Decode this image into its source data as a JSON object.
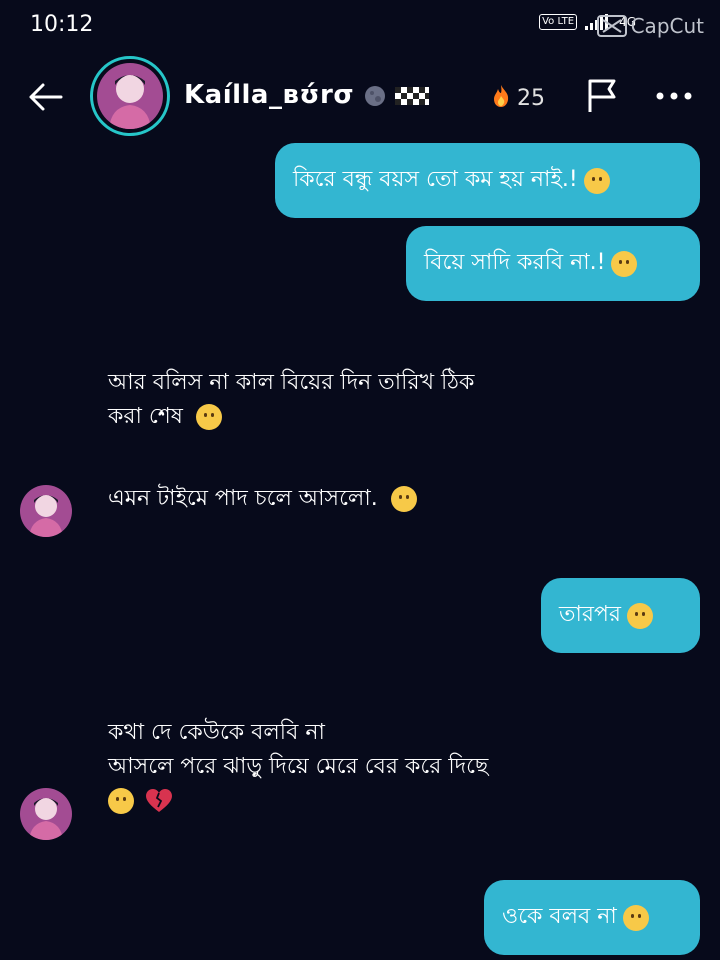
{
  "status_bar": {
    "time": "10:12",
    "volte": "Vo LTE",
    "network": "4G",
    "watermark": "CapCut"
  },
  "header": {
    "username": "Kaílla_вʊ́rσ",
    "streak_count": "25"
  },
  "messages": [
    {
      "dir": "out",
      "text": "কিরে বন্ধু বয়স তো কম হয় নাই.!",
      "emoji": "slightly-smiling-emoji"
    },
    {
      "dir": "out",
      "text": "বিয়ে সাদি করবি না.!",
      "emoji": "unamused-emoji"
    },
    {
      "dir": "in",
      "line1": "আর বলিস না কাল বিয়ের দিন তারিখ ঠিক",
      "line2": "করা শেষ",
      "emoji": "hugging-emoji"
    },
    {
      "dir": "in",
      "text": "এমন টাইমে পাদ চলে আসলো.",
      "emoji": "disappointed-emoji"
    },
    {
      "dir": "out",
      "text": "তারপর",
      "emoji": "thinking-emoji"
    },
    {
      "dir": "in",
      "line1": "কথা দে কেউকে বলবি না",
      "line2": "আসলে পরে ঝাড়ু দিয়ে মেরে বের করে দিছে",
      "emoji": "confused-emoji",
      "emoji2": "broken-heart-emoji"
    },
    {
      "dir": "out",
      "text": "ওকে বলব না",
      "emoji": "slightly-smiling-emoji"
    }
  ],
  "colors": {
    "background": "#070a1b",
    "outgoing_bubble": "#33b6d1",
    "avatar_ring": "#26c6c9"
  }
}
